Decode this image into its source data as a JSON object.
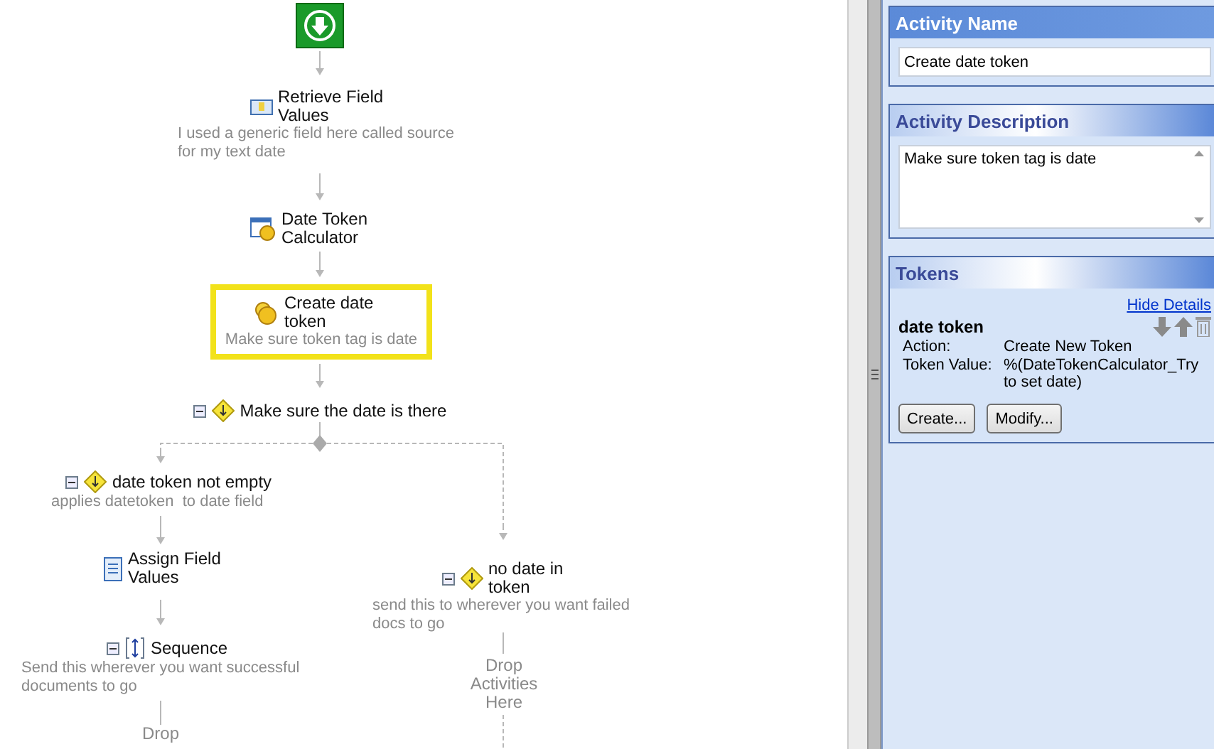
{
  "canvas": {
    "nodes": [
      {
        "kind": "start",
        "selected": false
      },
      {
        "kind": "activity",
        "title": "Retrieve Field Values",
        "description": "I used a generic field here called source for my text date",
        "selected": false
      },
      {
        "kind": "activity",
        "title": "Date Token Calculator",
        "selected": false
      },
      {
        "kind": "activity",
        "title": "Create date token",
        "description": "Make sure token tag is date",
        "selected": true
      },
      {
        "kind": "condition",
        "title": "Make sure the date is there",
        "selected": false
      },
      {
        "kind": "condition",
        "title": "date token not empty",
        "description": "applies datetoken  to date field",
        "selected": false
      },
      {
        "kind": "activity",
        "title": "Assign Field Values",
        "selected": false
      },
      {
        "kind": "condition",
        "title": "no date in token",
        "description": "send this to wherever you want failed docs to go",
        "selected": false
      },
      {
        "kind": "sequence",
        "title": "Sequence",
        "description": "Send this wherever you want successful documents to go",
        "selected": false
      },
      {
        "kind": "drop",
        "title": "Drop Activities Here",
        "selected": false
      },
      {
        "kind": "drop",
        "title": "Drop",
        "selected": false
      }
    ]
  },
  "properties": {
    "sections": [
      {
        "kind": "name",
        "header": "Activity Name",
        "active": true,
        "value": "Create date token"
      },
      {
        "kind": "description",
        "header": "Activity Description",
        "active": false,
        "value": "Make sure token tag is date"
      },
      {
        "kind": "tokens",
        "header": "Tokens",
        "active": false,
        "link": "Hide Details",
        "token": {
          "name": "date token",
          "rows": [
            {
              "label": "Action:",
              "value": "Create New Token"
            },
            {
              "label": "Token Value:",
              "value": "%(DateTokenCalculator_Try to set date)"
            }
          ]
        },
        "buttons": [
          "Create...",
          "Modify..."
        ]
      }
    ]
  }
}
